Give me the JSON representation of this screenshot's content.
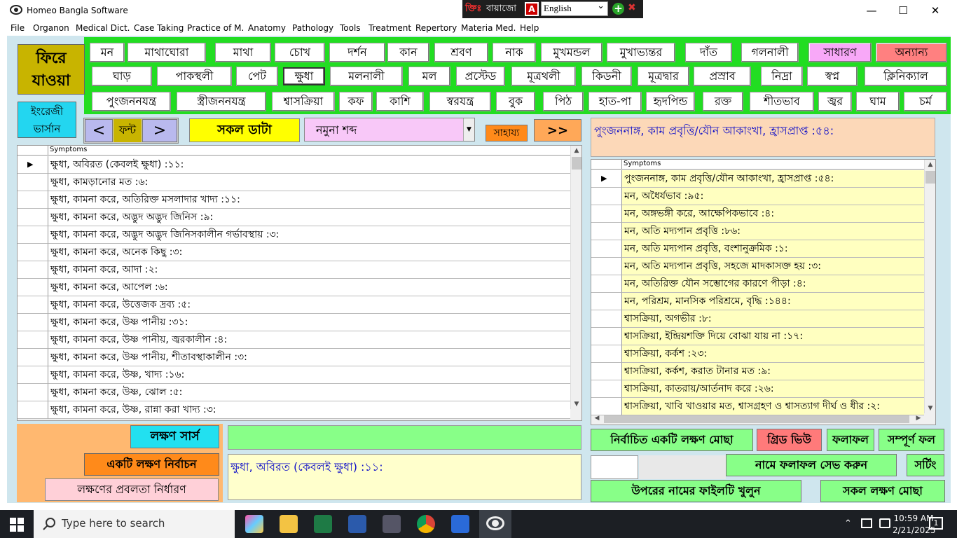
{
  "window": {
    "title": "Homeo Bangla Software",
    "minimize": "—",
    "maximize": "☐",
    "close": "✕"
  },
  "langbar": {
    "red_label": "ক্তিঃ",
    "keyboard": "বায়াজো",
    "a_icon": "A",
    "language": "English",
    "plus": "+",
    "tool": "✖"
  },
  "menu": [
    "File",
    "Organon",
    "Medical Dict.",
    "Case Taking",
    "Practice of M.",
    "Anatomy",
    "Pathology",
    "Tools",
    "Treatment",
    "Repertory",
    "Materia Med.",
    "Help"
  ],
  "back_button": {
    "line1": "ফিরে",
    "line2": "যাওয়া"
  },
  "english_button": {
    "line1": "ইংরেজী",
    "line2": "ভার্সান"
  },
  "categories": {
    "row1": [
      "মন",
      "মাথাঘোরা",
      "মাথা",
      "চোখ",
      "দর্শন",
      "কান",
      "শ্রবণ",
      "নাক",
      "মুখমন্ডল",
      "মুখাভ্যন্তর",
      "দাঁত",
      "গলনালী",
      "সাধারণ",
      "অন্যান্য"
    ],
    "row2": [
      "ঘাড়",
      "পাকস্থলী",
      "পেট",
      "ক্ষুধা",
      "মলনালী",
      "মল",
      "প্রস্টেড",
      "মূত্রথলী",
      "কিডনী",
      "মূত্রদ্বার",
      "প্রস্রাব",
      "নিদ্রা",
      "স্বপ্ন",
      "ক্লিনিক্যাল"
    ],
    "row3": [
      "পুংজননযন্ত্র",
      "স্ত্রীজননযন্ত্র",
      "শ্বাসক্রিয়া",
      "কফ",
      "কাশি",
      "স্বরযন্ত্র",
      "বুক",
      "পিঠ",
      "হাত-পা",
      "হৃদপিন্ড",
      "রক্ত",
      "শীতভাব",
      "জ্বর",
      "ঘাম",
      "চর্ম"
    ]
  },
  "nav": {
    "prev": "<",
    "font": "ফন্ট",
    "next": ">"
  },
  "all_data": "সকল ডাটা",
  "search": {
    "value": "নমুনা শব্দ",
    "arrow": "▼"
  },
  "help": "সাহায্য",
  "forward": ">>",
  "selected_top": "পুংজননাঙ্গ, কাম প্রবৃত্তি/যৌন আকাংখা, হ্রাসপ্রাপ্ত :৫৪:",
  "left_grid": {
    "header": "Symptoms",
    "current_marker": "▶",
    "rows": [
      "ক্ষুধা, অবিরত (কেবলই ক্ষুধা) :১১:",
      "ক্ষুধা, কামড়ানোর মত :৬:",
      "ক্ষুধা, কামনা করে, অতিরিক্ত মসলাদার খাদ্য :১১:",
      "ক্ষুধা, কামনা করে, অদ্ভুদ অদ্ভুদ জিনিস :৯:",
      "ক্ষুধা, কামনা করে, অদ্ভুদ অদ্ভুদ জিনিসকালীন গর্ভাবস্থায় :৩:",
      "ক্ষুধা, কামনা করে, অনেক কিছু :৩:",
      "ক্ষুধা, কামনা করে, আদা :২:",
      "ক্ষুধা, কামনা করে, আপেল :৬:",
      "ক্ষুধা, কামনা করে, উত্তেজক দ্রব্য :৫:",
      "ক্ষুধা, কামনা করে, উষ্ণ পানীয় :৩১:",
      "ক্ষুধা, কামনা করে, উষ্ণ পানীয়, জ্বরকালীন :৪:",
      "ক্ষুধা, কামনা করে, উষ্ণ পানীয়, শীতাবস্থাকালীন :৩:",
      "ক্ষুধা, কামনা করে, উষ্ণ, খাদ্য :১৬:",
      "ক্ষুধা, কামনা করে, উষ্ণ, ঝোল :৫:",
      "ক্ষুধা, কামনা করে, উষ্ণ, রান্না করা খাদ্য :৩:"
    ]
  },
  "right_grid": {
    "header": "Symptoms",
    "current_marker": "▶",
    "rows": [
      "পুংজননাঙ্গ, কাম প্রবৃত্তি/যৌন আকাংখা, হ্রাসপ্রাপ্ত :৫৪:",
      "মন, অধৈর্যভাব :৯৫:",
      "মন, অঙ্গভঙ্গী করে, আক্ষেপিকভাবে :৪:",
      "মন, অতি মদ্যপান প্রবৃত্তি :৮৬:",
      "মন, অতি মদ্যপান প্রবৃত্তি, বংশানুক্রমিক :১:",
      "মন, অতি মদ্যপান প্রবৃত্তি, সহজে মাদকাসক্ত হয় :৩:",
      "মন, অতিরিক্ত যৌন সম্ভোগের কারণে পীড়া :৪:",
      "মন, পরিশ্রম, মানসিক পরিশ্রমে, বৃদ্ধি :১৪৪:",
      "শ্বাসক্রিয়া, অগভীর :৮:",
      "শ্বাসক্রিয়া, ইন্দ্রিয়শক্তি দিয়ে বোঝা যায় না :১৭:",
      "শ্বাসক্রিয়া, কর্কশ :২৩:",
      "শ্বাসক্রিয়া, কর্কশ, করাত টানার মত :৯:",
      "শ্বাসক্রিয়া, কাতরায়/আর্তনাদ করে :২৬:",
      "শ্বাসক্রিয়া, খাবি খাওয়ার মত, শ্বাসগ্রহণ ও শ্বাসত্যাগ দীর্ঘ ও ধীর :২:"
    ]
  },
  "bottom": {
    "symptom_check": "লক্ষণ সার্স",
    "pick_one": "একটি লক্ষণ নির্বাচন",
    "prevalence": "লক্ষণের প্রবলতা নির্ধারণ",
    "selected_value": "ক্ষুধা, অবিরত (কেবলই ক্ষুধা) :১১:"
  },
  "right_buttons": {
    "delete_one": "নির্বাচিত একটি লক্ষণ মোছা",
    "grid_view": "গ্রিড ভিউ",
    "result": "ফলাফল",
    "full_result": "সম্পূর্ণ ফল",
    "save_result": "নামে ফলাফল সেভ করুন",
    "sorting": "সর্টিং",
    "open_file": "উপরের নামের ফাইলটি খুলুন",
    "delete_all": "সকল লক্ষণ মোছা"
  },
  "taskbar": {
    "search_placeholder": "Type here to search",
    "time": "10:59 AM",
    "date": "2/21/2025",
    "notifications": "1"
  },
  "colors": {
    "green_panel": "#22dd22",
    "accent_blue": "#1010c8",
    "yellow_cells": "#ffffc0"
  }
}
